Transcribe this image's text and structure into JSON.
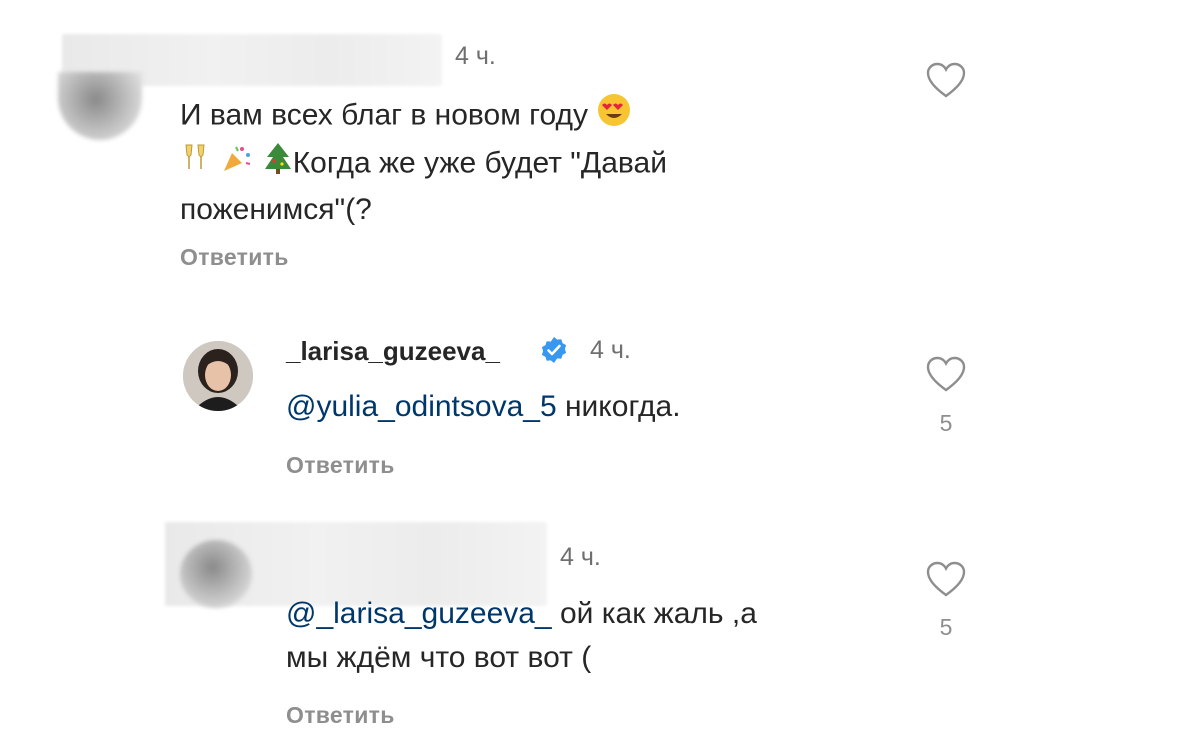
{
  "comments": [
    {
      "time": "4 ч.",
      "text_line1": "И вам всех благ в новом году",
      "text_line2": "Когда же уже будет \"Давай",
      "text_line3": "поженимся\"(?",
      "reply_label": "Ответить",
      "heart_icon": "heart-outline-icon"
    },
    {
      "username": "_larisa_guzeeva_",
      "verified": true,
      "time": "4 ч.",
      "mention": "@yulia_odintsova_5",
      "text": " никогда.",
      "reply_label": "Ответить",
      "likes": "5",
      "heart_icon": "heart-outline-icon"
    },
    {
      "time": "4 ч.",
      "mention": "@_larisa_guzeeva_",
      "text_line1": " ой как жаль ,а",
      "text_line2": "мы ждём что вот вот (",
      "reply_label": "Ответить",
      "likes": "5",
      "heart_icon": "heart-outline-icon"
    }
  ],
  "colors": {
    "text": "#262626",
    "secondary": "#8e8e8e",
    "mention": "#00376b",
    "verified": "#3897f0"
  }
}
